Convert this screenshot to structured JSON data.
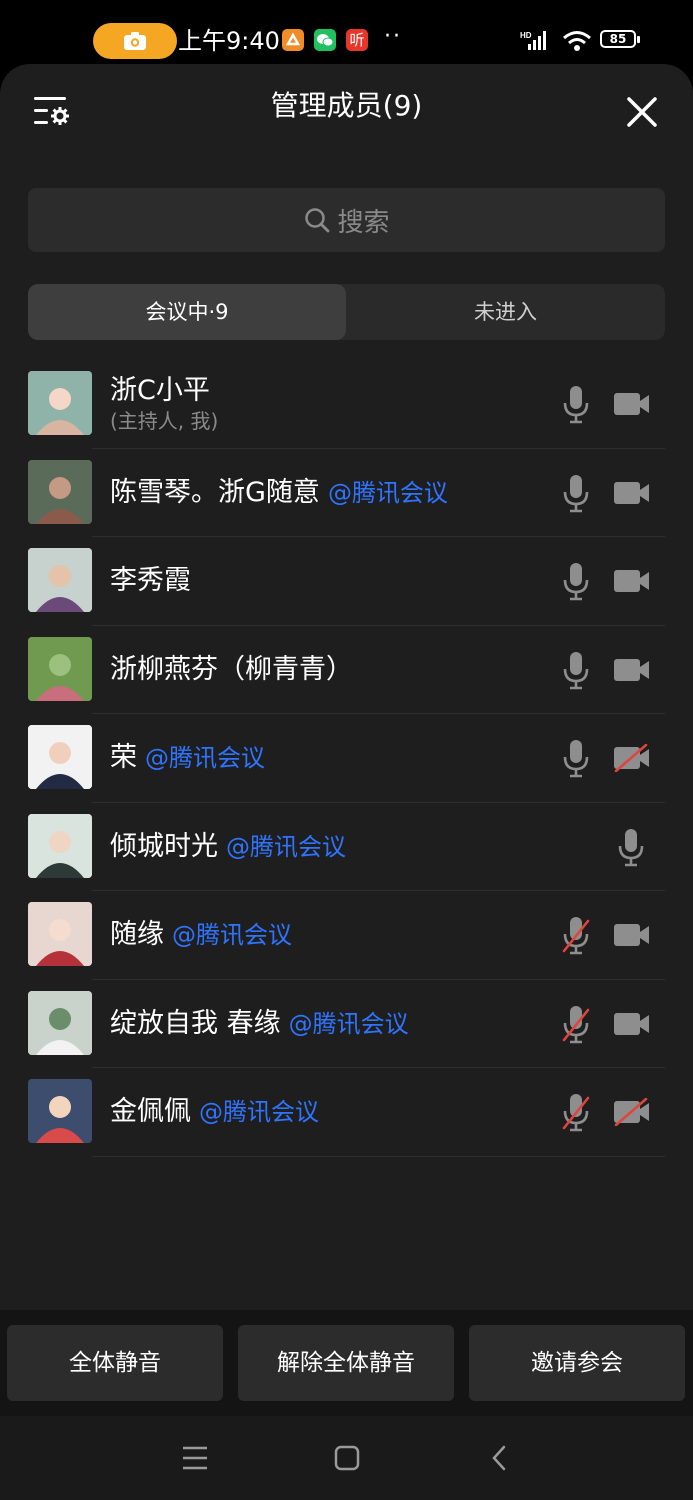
{
  "status_bar": {
    "time": "上午9:40",
    "notification_icons": [
      "camera-recording-icon",
      "xiaomi-app-icon",
      "wechat-icon",
      "ting-app-icon"
    ],
    "app_label": "听",
    "dots": "··",
    "network": "HD",
    "battery": "85"
  },
  "header": {
    "title": "管理成员(9)"
  },
  "search": {
    "placeholder": "搜索"
  },
  "tabs": [
    {
      "label": "会议中·9",
      "active": true
    },
    {
      "label": "未进入",
      "active": false
    }
  ],
  "participants": [
    {
      "name": "浙C小平",
      "sub": "(主持人, 我)",
      "ext": "",
      "mic": "on",
      "cam": "on"
    },
    {
      "name": "陈雪琴。浙G随意",
      "sub": "",
      "ext": "@腾讯会议",
      "mic": "on",
      "cam": "on"
    },
    {
      "name": "李秀霞",
      "sub": "",
      "ext": "",
      "mic": "on",
      "cam": "on"
    },
    {
      "name": "浙柳燕芬（柳青青）",
      "sub": "",
      "ext": "",
      "mic": "on",
      "cam": "on"
    },
    {
      "name": "荣",
      "sub": "",
      "ext": "@腾讯会议",
      "mic": "on",
      "cam": "off"
    },
    {
      "name": "倾城时光",
      "sub": "",
      "ext": "@腾讯会议",
      "mic": "on",
      "cam": "none"
    },
    {
      "name": "随缘",
      "sub": "",
      "ext": "@腾讯会议",
      "mic": "off",
      "cam": "on"
    },
    {
      "name": "绽放自我    春缘",
      "sub": "",
      "ext": "@腾讯会议",
      "mic": "off",
      "cam": "on"
    },
    {
      "name": "金佩佩",
      "sub": "",
      "ext": "@腾讯会议",
      "mic": "off",
      "cam": "off"
    }
  ],
  "footer": {
    "mute_all": "全体静音",
    "unmute_all": "解除全体静音",
    "invite": "邀请参会"
  },
  "colors": {
    "accent_blue": "#2f74ff",
    "muted_red": "#e0443a",
    "panel_bg": "#1e1e1e"
  }
}
